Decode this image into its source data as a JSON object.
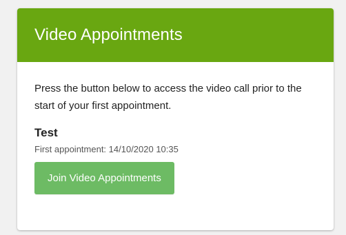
{
  "card": {
    "title": "Video Appointments",
    "description": "Press the button below to access the video call prior to the start of your first appointment.",
    "appointment": {
      "name": "Test",
      "first_appointment": "First appointment: 14/10/2020 10:35"
    },
    "join_button_label": "Join Video Appointments"
  },
  "colors": {
    "header_bg": "#69a711",
    "button_bg": "#6dbb64",
    "page_bg": "#f1f1f1"
  }
}
